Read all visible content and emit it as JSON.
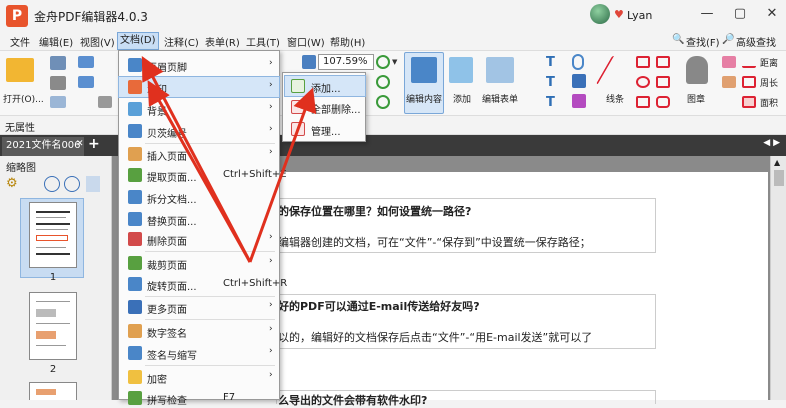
{
  "app": {
    "logo": "P",
    "title": "金舟PDF编辑器4.0.3",
    "user_name": "Lyan"
  },
  "window_controls": {
    "minimize": "—",
    "maximize": "▢",
    "close": "✕"
  },
  "menubar": {
    "items": [
      "文件",
      "编辑(E)",
      "视图(V)",
      "文档(D)",
      "注释(C)",
      "表单(R)",
      "工具(T)",
      "窗口(W)",
      "帮助(H)"
    ],
    "find": "查找(F)",
    "adv_find": "高级查找"
  },
  "ribbon": {
    "open_label": "打开(O)...",
    "zoom_value": "107.59%",
    "edit_content": "编辑内容",
    "add": "添加",
    "edit_form": "编辑表单",
    "line": "线条",
    "stamp": "图章",
    "distance": "距离",
    "perimeter": "周长",
    "area": "面积"
  },
  "propbar": {
    "label": "无属性"
  },
  "tabs": {
    "doc_tab": "2021文件名006",
    "close": "✕",
    "add": "+",
    "nav": "◀ ▶"
  },
  "thumbnails": {
    "title": "缩略图",
    "pages": [
      "1",
      "2"
    ]
  },
  "context_menu": {
    "items": [
      {
        "label": "页眉页脚",
        "shortcut": "",
        "arrow": "›"
      },
      {
        "label": "水印",
        "shortcut": "",
        "arrow": "›"
      },
      {
        "label": "背景",
        "shortcut": "",
        "arrow": "›"
      },
      {
        "label": "贝茨编号",
        "shortcut": "",
        "arrow": "›"
      },
      {
        "label": "插入页面",
        "shortcut": "",
        "arrow": "›"
      },
      {
        "label": "提取页面...",
        "shortcut": "Ctrl+Shift+E",
        "arrow": ""
      },
      {
        "label": "拆分文档...",
        "shortcut": "",
        "arrow": ""
      },
      {
        "label": "替换页面...",
        "shortcut": "",
        "arrow": ""
      },
      {
        "label": "删除页面",
        "shortcut": "",
        "arrow": "›"
      },
      {
        "label": "裁剪页面",
        "shortcut": "",
        "arrow": "›"
      },
      {
        "label": "旋转页面...",
        "shortcut": "Ctrl+Shift+R",
        "arrow": ""
      },
      {
        "label": "更多页面",
        "shortcut": "",
        "arrow": "›"
      },
      {
        "label": "数字签名",
        "shortcut": "",
        "arrow": "›"
      },
      {
        "label": "签名与缩写",
        "shortcut": "",
        "arrow": "›"
      },
      {
        "label": "加密",
        "shortcut": "",
        "arrow": "›"
      },
      {
        "label": "拼写检查",
        "shortcut": "F7",
        "arrow": ""
      }
    ]
  },
  "submenu": {
    "items": [
      "添加...",
      "全部删除...",
      "管理..."
    ]
  },
  "document": {
    "q1_title": "的保存位置在哪里？如何设置统一路径?",
    "q1_body": "编辑器创建的文档，可在“文件”-“保存到”中设置统一保存路径；",
    "q2_title": "好的PDF可以通过E-mail传送给好友吗?",
    "q2_body": "以的，编辑好的文档保存后点击“文件”-“用E-mail发送”就可以了",
    "q3_title": "么导出的文件会带有软件水印?"
  },
  "colors": {
    "highlight": "#d5e6f8",
    "arrow": "#e0301e",
    "logo": "#e8542c"
  }
}
